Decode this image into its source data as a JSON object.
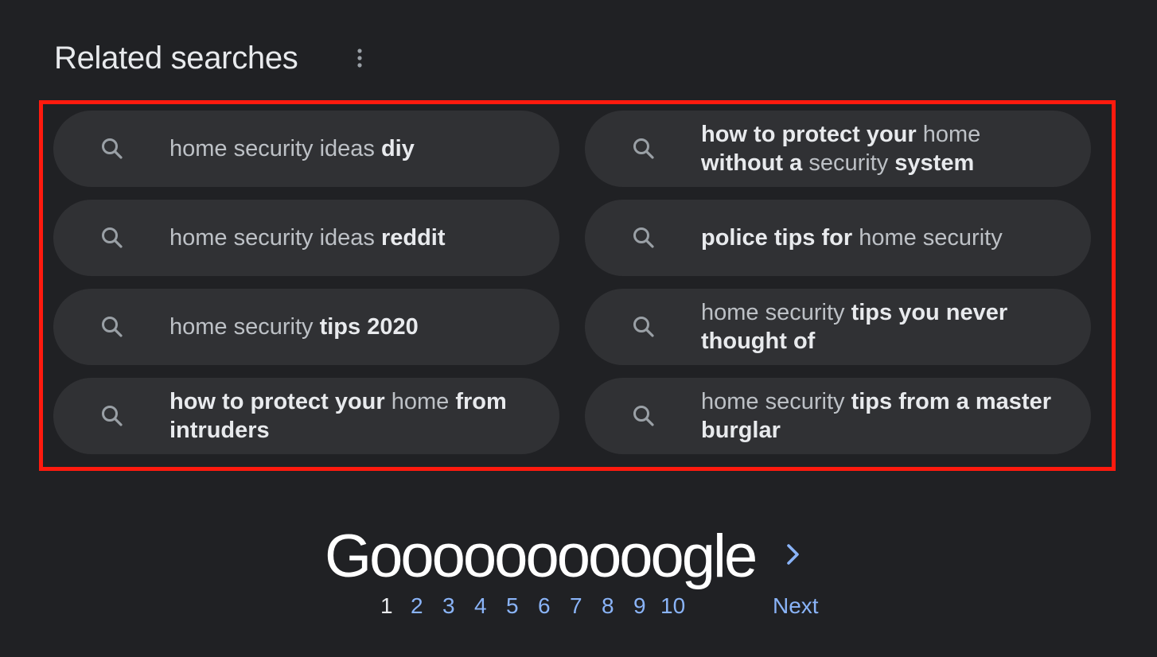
{
  "related": {
    "heading": "Related searches",
    "more_icon": "vertical-dots-icon",
    "search_icon": "search-icon",
    "items": [
      {
        "parts": [
          {
            "t": "home security ideas ",
            "b": false
          },
          {
            "t": "diy",
            "b": true
          }
        ]
      },
      {
        "parts": [
          {
            "t": "how to protect your",
            "b": true
          },
          {
            "t": " home ",
            "b": false
          },
          {
            "t": "without a",
            "b": true
          },
          {
            "t": " security ",
            "b": false
          },
          {
            "t": "system",
            "b": true
          }
        ]
      },
      {
        "parts": [
          {
            "t": "home security ideas ",
            "b": false
          },
          {
            "t": "reddit",
            "b": true
          }
        ]
      },
      {
        "parts": [
          {
            "t": "police tips for",
            "b": true
          },
          {
            "t": " home security",
            "b": false
          }
        ]
      },
      {
        "parts": [
          {
            "t": "home security ",
            "b": false
          },
          {
            "t": "tips 2020",
            "b": true
          }
        ]
      },
      {
        "parts": [
          {
            "t": "home security ",
            "b": false
          },
          {
            "t": "tips you never thought of",
            "b": true
          }
        ]
      },
      {
        "parts": [
          {
            "t": "how to protect your",
            "b": true
          },
          {
            "t": " home ",
            "b": false
          },
          {
            "t": "from intruders",
            "b": true
          }
        ]
      },
      {
        "parts": [
          {
            "t": "home security ",
            "b": false
          },
          {
            "t": "tips from a master burglar",
            "b": true
          }
        ]
      }
    ]
  },
  "pagination": {
    "logo": "Goooooooooogle",
    "next_icon": "chevron-right-icon",
    "pages": [
      "1",
      "2",
      "3",
      "4",
      "5",
      "6",
      "7",
      "8",
      "9",
      "10"
    ],
    "current": "1",
    "next_label": "Next"
  },
  "colors": {
    "background": "#202124",
    "chip": "#303134",
    "highlight": "#ff1a0e",
    "link": "#8ab4f8"
  }
}
